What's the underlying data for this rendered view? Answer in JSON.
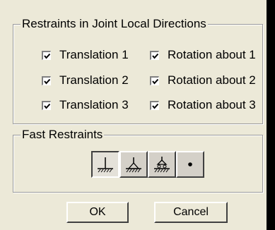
{
  "restraints_group": {
    "title": "Restraints in Joint Local Directions",
    "items": [
      {
        "label": "Translation  1",
        "checked": true
      },
      {
        "label": "Rotation about  1",
        "checked": true
      },
      {
        "label": "Translation  2",
        "checked": true
      },
      {
        "label": "Rotation about  2",
        "checked": true
      },
      {
        "label": "Translation  3",
        "checked": true
      },
      {
        "label": "Rotation about  3",
        "checked": true
      }
    ]
  },
  "fast_restraints": {
    "title": "Fast Restraints",
    "buttons": [
      {
        "icon": "fixed-support-icon",
        "pressed": true
      },
      {
        "icon": "pinned-support-icon",
        "pressed": false
      },
      {
        "icon": "roller-support-icon",
        "pressed": false
      },
      {
        "icon": "free-joint-icon",
        "pressed": false
      }
    ]
  },
  "actions": {
    "ok_label": "OK",
    "cancel_label": "Cancel"
  }
}
